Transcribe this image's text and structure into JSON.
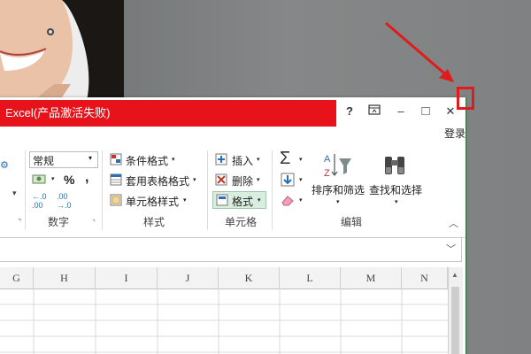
{
  "window": {
    "title": "Excel(产品激活失败)",
    "help_icon": "?",
    "restore_ribbon_icon": "ribbon-display-icon",
    "minimize_icon": "–",
    "maximize_icon": "□",
    "close_icon": "✕",
    "login_label": "登录"
  },
  "ribbon": {
    "number": {
      "format_value": "常规",
      "percent": "%",
      "comma": ",",
      "group_label": "数字"
    },
    "styles": {
      "conditional_format": "条件格式",
      "table_format": "套用表格格式",
      "cell_styles": "单元格样式",
      "group_label": "样式"
    },
    "cells": {
      "insert": "插入",
      "delete": "删除",
      "format": "格式",
      "group_label": "单元格"
    },
    "editing": {
      "sort_filter": "排序和筛选",
      "find_select": "查找和选择",
      "group_label": "编辑"
    }
  },
  "columns": [
    "G",
    "H",
    "I",
    "J",
    "K",
    "L",
    "M",
    "N"
  ],
  "colors": {
    "title_bar": "#e8131a",
    "highlight_box": "#e01b1b",
    "arrow": "#e01b1b",
    "format_button_active": "#d9eee0"
  }
}
